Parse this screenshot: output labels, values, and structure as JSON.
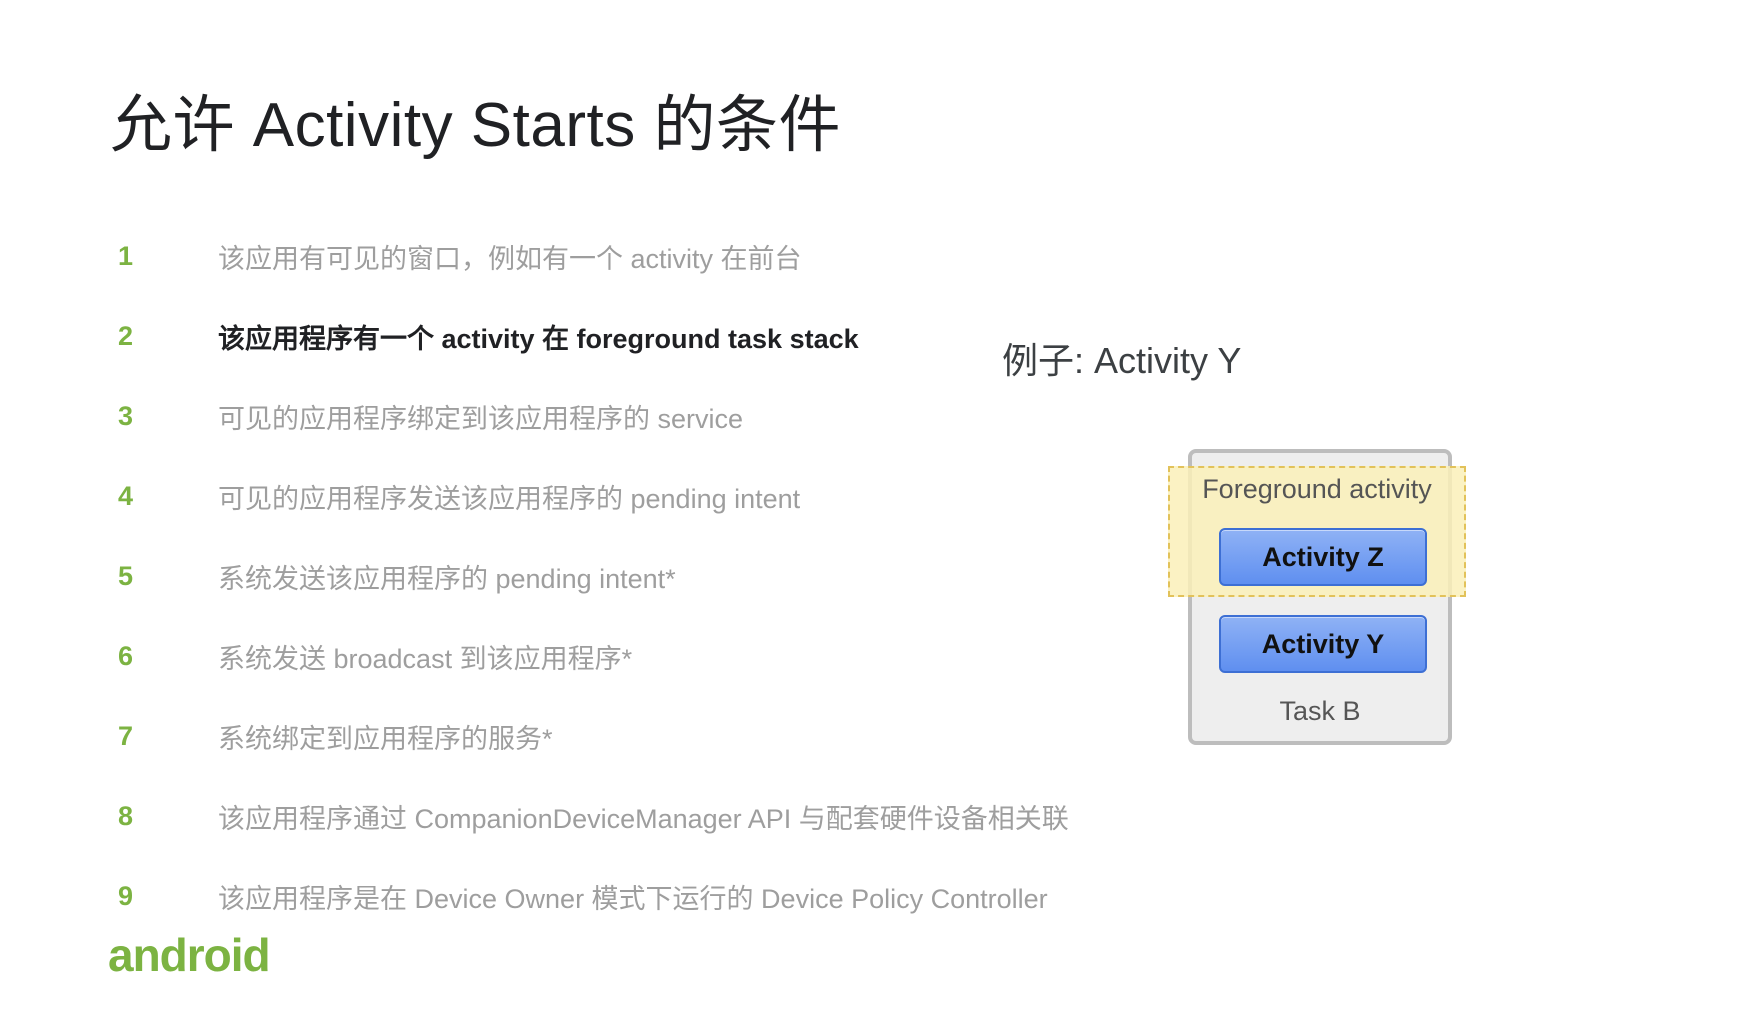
{
  "slide": {
    "title": "允许 Activity Starts 的条件"
  },
  "conditions": [
    {
      "num": "1",
      "text": "该应用有可见的窗口，例如有一个 activity 在前台",
      "highlight": false
    },
    {
      "num": "2",
      "text": "该应用程序有一个 activity 在 foreground task stack",
      "highlight": true
    },
    {
      "num": "3",
      "text": "可见的应用程序绑定到该应用程序的 service",
      "highlight": false
    },
    {
      "num": "4",
      "text": "可见的应用程序发送该应用程序的 pending intent",
      "highlight": false
    },
    {
      "num": "5",
      "text": "系统发送该应用程序的 pending intent*",
      "highlight": false
    },
    {
      "num": "6",
      "text": "系统发送 broadcast 到该应用程序*",
      "highlight": false
    },
    {
      "num": "7",
      "text": "系统绑定到应用程序的服务*",
      "highlight": false
    },
    {
      "num": "8",
      "text": "该应用程序通过 CompanionDeviceManager API 与配套硬件设备相关联",
      "highlight": false
    },
    {
      "num": "9",
      "text": "该应用程序是在 Device Owner 模式下运行的 Device Policy Controller",
      "highlight": false
    }
  ],
  "example": {
    "label": "例子: Activity Y",
    "foreground_label": "Foreground activity",
    "activity_z": "Activity Z",
    "activity_y": "Activity Y",
    "task_label": "Task B"
  },
  "branding": {
    "logo_text": "android"
  },
  "colors": {
    "accent_green": "#7cb342",
    "activity_blue": "#6f9cf2",
    "foreground_yellow": "#faf0b9"
  }
}
